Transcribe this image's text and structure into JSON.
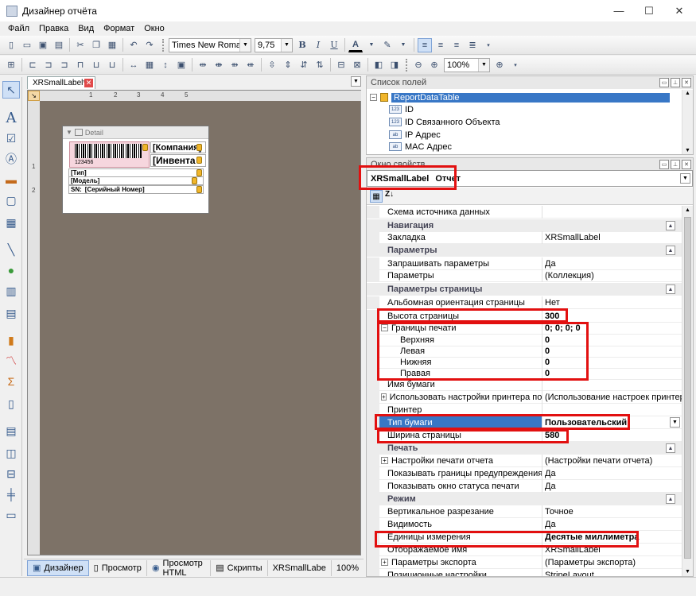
{
  "window": {
    "title": "Дизайнер отчёта",
    "minimize": "—",
    "maximize": "☐",
    "close": "✕"
  },
  "menu": [
    "Файл",
    "Правка",
    "Вид",
    "Формат",
    "Окно"
  ],
  "format_toolbar": {
    "font_family": "Times New Roman",
    "font_size": "9,75",
    "bold": "B",
    "italic": "I",
    "underline": "U",
    "font_color": "A"
  },
  "layout_toolbar": {
    "zoom": "100%"
  },
  "document": {
    "tab_label": "XRSmallLabel*",
    "band_caption": "Detail",
    "ruler_marks": [
      "1",
      "2",
      "3",
      "4",
      "5"
    ],
    "ruler_v_marks": [
      "1",
      "2"
    ]
  },
  "label": {
    "barcode_text": "123456",
    "company": "[Компания]",
    "inventory": "[Инвента",
    "type": "[Тип]",
    "model": "[Модель]",
    "serial_prefix": "SN:",
    "serial": "[Серийный Номер]"
  },
  "statusbar": {
    "designer": "Дизайнер",
    "preview": "Просмотр",
    "preview_html": "Просмотр HTML",
    "scripts": "Скрипты",
    "report_name": "XRSmallLabe",
    "zoom": "100%"
  },
  "field_list": {
    "title": "Список полей",
    "root": "ReportDataTable",
    "fields": [
      {
        "icon": "123",
        "label": "ID"
      },
      {
        "icon": "123",
        "label": "ID Связанного Объекта"
      },
      {
        "icon": "ab",
        "label": "IP Адрес"
      },
      {
        "icon": "ab",
        "label": "MAC Адрес"
      }
    ]
  },
  "properties": {
    "title": "Окно свойств",
    "object_name": "XRSmallLabel",
    "object_type": "Отчет",
    "sort_label": "Z↓",
    "rows": [
      {
        "kind": "prop",
        "name": "Схема источника данных",
        "value": ""
      },
      {
        "kind": "cat",
        "name": "Навигация"
      },
      {
        "kind": "prop",
        "name": "Закладка",
        "value": "XRSmallLabel"
      },
      {
        "kind": "cat",
        "name": "Параметры"
      },
      {
        "kind": "prop",
        "name": "Запрашивать параметры",
        "value": "Да"
      },
      {
        "kind": "prop",
        "name": "Параметры",
        "value": "(Коллекция)"
      },
      {
        "kind": "cat",
        "name": "Параметры страницы"
      },
      {
        "kind": "prop",
        "name": "Альбомная ориентация страницы",
        "value": "Нет"
      },
      {
        "kind": "prop",
        "name": "Высота страницы",
        "value": "300",
        "bold": true
      },
      {
        "kind": "expand",
        "name": "Границы печати",
        "value": "0; 0; 0; 0",
        "bold": true,
        "exp": "−"
      },
      {
        "kind": "sub",
        "name": "Верхняя",
        "value": "0",
        "bold": true
      },
      {
        "kind": "sub",
        "name": "Левая",
        "value": "0",
        "bold": true
      },
      {
        "kind": "sub",
        "name": "Нижняя",
        "value": "0",
        "bold": true
      },
      {
        "kind": "sub",
        "name": "Правая",
        "value": "0",
        "bold": true
      },
      {
        "kind": "prop",
        "name": "Имя бумаги",
        "value": ""
      },
      {
        "kind": "expand",
        "name": "Использовать настройки принтера по умолчанию",
        "value": "(Использование настроек принтера)",
        "exp": "+"
      },
      {
        "kind": "prop",
        "name": "Принтер",
        "value": ""
      },
      {
        "kind": "sel",
        "name": "Тип бумаги",
        "value": "Пользовательский",
        "bold": true
      },
      {
        "kind": "prop",
        "name": "Ширина страницы",
        "value": "580",
        "bold": true
      },
      {
        "kind": "cat",
        "name": "Печать"
      },
      {
        "kind": "expand",
        "name": "Настройки печати отчета",
        "value": "(Настройки печати отчета)",
        "exp": "+"
      },
      {
        "kind": "prop",
        "name": "Показывать границы предупреждения печати",
        "value": "Да"
      },
      {
        "kind": "prop",
        "name": "Показывать окно статуса печати",
        "value": "Да"
      },
      {
        "kind": "cat",
        "name": "Режим"
      },
      {
        "kind": "prop",
        "name": "Вертикальное разрезание",
        "value": "Точное"
      },
      {
        "kind": "prop",
        "name": "Видимость",
        "value": "Да"
      },
      {
        "kind": "prop",
        "name": "Единицы измерения",
        "value": "Десятые миллиметра",
        "bold": true
      },
      {
        "kind": "prop",
        "name": "Отображаемое имя",
        "value": "XRSmallLabel"
      },
      {
        "kind": "expand",
        "name": "Параметры экспорта",
        "value": "(Параметры экспорта)",
        "exp": "+"
      },
      {
        "kind": "prop",
        "name": "Позиционные настройки",
        "value": "StripeLayout"
      }
    ]
  },
  "colors": {
    "highlight": "#e21010",
    "selection": "#3877c6",
    "design_surface": "#7d7267"
  }
}
